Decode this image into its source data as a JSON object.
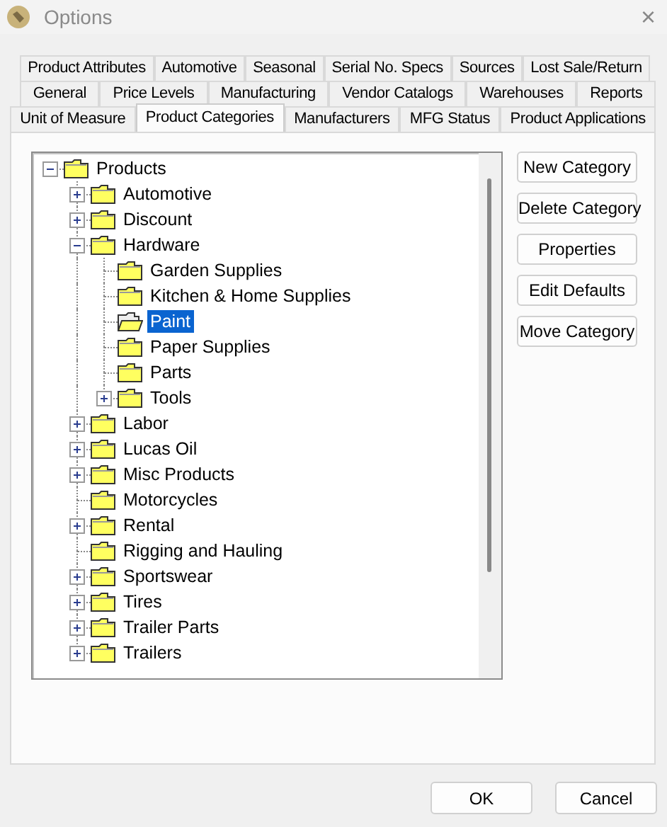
{
  "window": {
    "title": "Options",
    "close": "×"
  },
  "tab_rows": [
    [
      {
        "label": "Product Attributes",
        "selected": false
      },
      {
        "label": "Automotive",
        "selected": false
      },
      {
        "label": "Seasonal",
        "selected": false
      },
      {
        "label": "Serial No. Specs",
        "selected": false
      },
      {
        "label": "Sources",
        "selected": false
      },
      {
        "label": "Lost Sale/Return",
        "selected": false
      }
    ],
    [
      {
        "label": "General",
        "selected": false
      },
      {
        "label": "Price Levels",
        "selected": false
      },
      {
        "label": "Manufacturing",
        "selected": false
      },
      {
        "label": "Vendor Catalogs",
        "selected": false
      },
      {
        "label": "Warehouses",
        "selected": false
      },
      {
        "label": "Reports",
        "selected": false
      }
    ],
    [
      {
        "label": "Unit of Measure",
        "selected": false
      },
      {
        "label": "Product Categories",
        "selected": true
      },
      {
        "label": "Manufacturers",
        "selected": false
      },
      {
        "label": "MFG Status",
        "selected": false
      },
      {
        "label": "Product Applications",
        "selected": false
      }
    ]
  ],
  "tree": [
    {
      "label": "Products",
      "expanded": true,
      "selected": false,
      "children": [
        {
          "label": "Automotive",
          "expanded": false,
          "selected": false
        },
        {
          "label": "Discount",
          "expanded": false,
          "selected": false
        },
        {
          "label": "Hardware",
          "expanded": true,
          "selected": false,
          "children": [
            {
              "label": "Garden Supplies",
              "selected": false
            },
            {
              "label": "Kitchen & Home Supplies",
              "selected": false
            },
            {
              "label": "Paint",
              "selected": true
            },
            {
              "label": "Paper Supplies",
              "selected": false
            },
            {
              "label": "Parts",
              "selected": false
            },
            {
              "label": "Tools",
              "expanded": false,
              "selected": false
            }
          ]
        },
        {
          "label": "Labor",
          "expanded": false,
          "selected": false
        },
        {
          "label": "Lucas Oil",
          "expanded": false,
          "selected": false
        },
        {
          "label": "Misc Products",
          "expanded": false,
          "selected": false
        },
        {
          "label": "Motorcycles",
          "selected": false
        },
        {
          "label": "Rental",
          "expanded": false,
          "selected": false
        },
        {
          "label": "Rigging and Hauling",
          "selected": false
        },
        {
          "label": "Sportswear",
          "expanded": false,
          "selected": false
        },
        {
          "label": "Tires",
          "expanded": false,
          "selected": false
        },
        {
          "label": "Trailer Parts",
          "expanded": false,
          "selected": false
        },
        {
          "label": "Trailers",
          "expanded": false,
          "selected": false
        }
      ]
    }
  ],
  "side_buttons": [
    "New Category",
    "Delete Category",
    "Properties",
    "Edit Defaults",
    "Move Category"
  ],
  "footer_buttons": [
    "OK",
    "Cancel"
  ]
}
